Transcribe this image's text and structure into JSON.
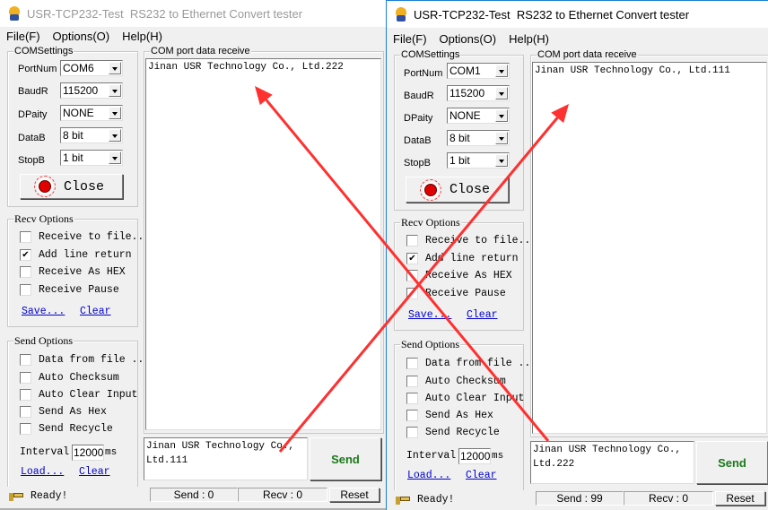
{
  "windows": [
    {
      "title": "USR-TCP232-Test  RS232 to Ethernet Convert tester",
      "menu": [
        "File(F)",
        "Options(O)",
        "Help(H)"
      ],
      "com_settings": {
        "legend": "COMSettings",
        "fields": [
          {
            "label": "PortNum",
            "value": "COM6"
          },
          {
            "label": "BaudR",
            "value": "115200"
          },
          {
            "label": "DPaity",
            "value": "NONE"
          },
          {
            "label": "DataB",
            "value": "8 bit"
          },
          {
            "label": "StopB",
            "value": "1 bit"
          }
        ],
        "close_button": "Close"
      },
      "recv_options": {
        "legend": "Recv Options",
        "checkboxes": [
          {
            "label": "Receive to file...",
            "checked": false
          },
          {
            "label": "Add line return",
            "checked": true
          },
          {
            "label": "Receive As HEX",
            "checked": false
          },
          {
            "label": "Receive Pause",
            "checked": false
          }
        ],
        "save_link": "Save...",
        "clear_link": "Clear"
      },
      "send_options": {
        "legend": "Send Options",
        "checkboxes": [
          {
            "label": "Data from file ...",
            "checked": false
          },
          {
            "label": "Auto Checksum",
            "checked": false
          },
          {
            "label": "Auto Clear Input",
            "checked": false
          },
          {
            "label": "Send As Hex",
            "checked": false
          },
          {
            "label": "Send Recycle",
            "checked": false
          }
        ],
        "interval_label": "Interval",
        "interval_value": "12000",
        "interval_unit": "ms",
        "load_link": "Load...",
        "clear_link": "Clear"
      },
      "receive": {
        "legend": "COM port data receive",
        "text": "Jinan USR Technology Co., Ltd.222"
      },
      "send_text": "Jinan USR Technology Co., Ltd.111",
      "send_button": "Send",
      "status": {
        "ready": "Ready!",
        "send": "Send : 0",
        "recv": "Recv : 0",
        "reset": "Reset"
      }
    },
    {
      "title": "USR-TCP232-Test  RS232 to Ethernet Convert tester",
      "menu": [
        "File(F)",
        "Options(O)",
        "Help(H)"
      ],
      "com_settings": {
        "legend": "COMSettings",
        "fields": [
          {
            "label": "PortNum",
            "value": "COM1"
          },
          {
            "label": "BaudR",
            "value": "115200"
          },
          {
            "label": "DPaity",
            "value": "NONE"
          },
          {
            "label": "DataB",
            "value": "8 bit"
          },
          {
            "label": "StopB",
            "value": "1 bit"
          }
        ],
        "close_button": "Close"
      },
      "recv_options": {
        "legend": "Recv Options",
        "checkboxes": [
          {
            "label": "Receive to file...",
            "checked": false
          },
          {
            "label": "Add line return",
            "checked": true
          },
          {
            "label": "Receive As HEX",
            "checked": false
          },
          {
            "label": "Receive Pause",
            "checked": false
          }
        ],
        "save_link": "Save...",
        "clear_link": "Clear"
      },
      "send_options": {
        "legend": "Send Options",
        "checkboxes": [
          {
            "label": "Data from file ...",
            "checked": false
          },
          {
            "label": "Auto Checksum",
            "checked": false
          },
          {
            "label": "Auto Clear Input",
            "checked": false
          },
          {
            "label": "Send As Hex",
            "checked": false
          },
          {
            "label": "Send Recycle",
            "checked": false
          }
        ],
        "interval_label": "Interval",
        "interval_value": "12000",
        "interval_unit": "ms",
        "load_link": "Load...",
        "clear_link": "Clear"
      },
      "receive": {
        "legend": "COM port data receive",
        "text": "Jinan USR Technology Co., Ltd.111"
      },
      "send_text": "Jinan USR Technology Co., Ltd.222",
      "send_button": "Send",
      "status": {
        "ready": "Ready!",
        "send": "Send : 99",
        "recv": "Recv : 0",
        "reset": "Reset"
      }
    }
  ],
  "annotation": {
    "arrow_color": "#ff3030"
  }
}
